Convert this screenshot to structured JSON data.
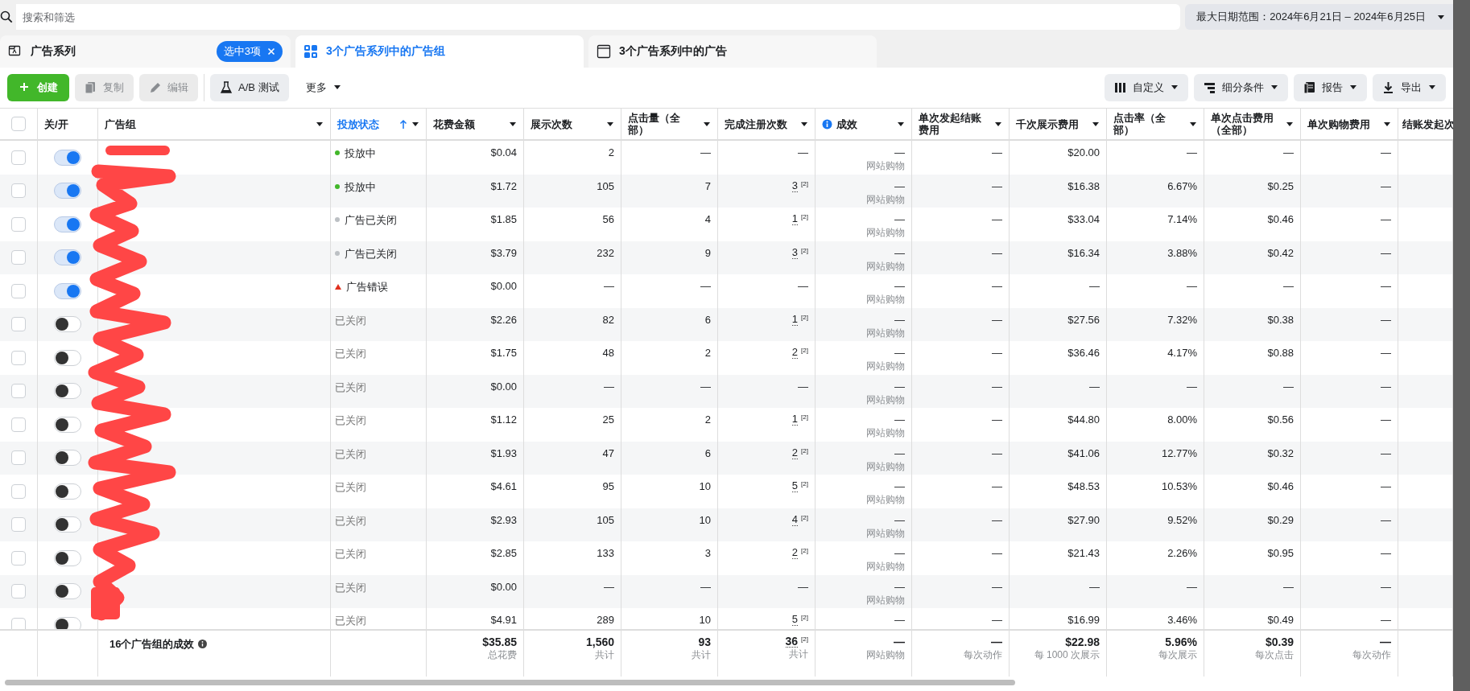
{
  "search": {
    "placeholder": "搜索和筛选"
  },
  "date_range": {
    "label": "最大日期范围：2024年6月21日 – 2024年6月25日"
  },
  "tabs": [
    {
      "label": "广告系列",
      "selected": false,
      "badge": "选中3项"
    },
    {
      "label": "3个广告系列中的广告组",
      "selected": true
    },
    {
      "label": "3个广告系列中的广告",
      "selected": false
    }
  ],
  "toolbar": {
    "left": [
      {
        "label": "创建",
        "kind": "primary",
        "disabled": false
      },
      {
        "label": "复制",
        "kind": "normal",
        "disabled": true
      },
      {
        "label": "编辑",
        "kind": "normal",
        "disabled": true
      },
      {
        "label": "A/B 测试",
        "kind": "normal",
        "disabled": false
      },
      {
        "label": "更多",
        "kind": "menu",
        "disabled": false
      }
    ],
    "right": [
      {
        "label": "自定义",
        "kind": "normal",
        "disabled": false
      },
      {
        "label": "细分条件",
        "kind": "normal",
        "disabled": false
      },
      {
        "label": "报告",
        "kind": "normal",
        "disabled": false
      },
      {
        "label": "导出",
        "kind": "normal",
        "disabled": false
      }
    ]
  },
  "table": {
    "select_all": {
      "checked": false
    },
    "columns": [
      {
        "label": "关/开",
        "sorted": false,
        "menu": false,
        "info": false
      },
      {
        "label": "广告组",
        "sorted": false,
        "menu": true,
        "info": false
      },
      {
        "label": "投放状态",
        "sorted": true,
        "menu": true,
        "info": false
      },
      {
        "label": "花费金额",
        "sorted": false,
        "menu": true,
        "info": false
      },
      {
        "label": "展示次数",
        "sorted": false,
        "menu": true,
        "info": false
      },
      {
        "label": "点击量（全部）",
        "sorted": false,
        "menu": true,
        "info": false
      },
      {
        "label": "完成注册次数",
        "sorted": false,
        "menu": true,
        "info": false
      },
      {
        "label": "成效",
        "sorted": false,
        "menu": true,
        "info": true
      },
      {
        "label": "单次发起结账费用",
        "sorted": false,
        "menu": true,
        "info": false
      },
      {
        "label": "千次展示费用",
        "sorted": false,
        "menu": true,
        "info": false
      },
      {
        "label": "点击率（全部）",
        "sorted": false,
        "menu": true,
        "info": false
      },
      {
        "label": "单次点击费用（全部）",
        "sorted": false,
        "menu": true,
        "info": false
      },
      {
        "label": "单次购物费用",
        "sorted": false,
        "menu": true,
        "info": false
      },
      {
        "label": "结账发起次",
        "sorted": false,
        "info": false
      }
    ],
    "rows": [
      {
        "checked": false,
        "on": true,
        "status": {
          "kind": "active",
          "label": "投放中"
        },
        "cells": [
          "$0.04",
          "2",
          "—",
          {
            "value": "—"
          },
          {
            "value": "—",
            "sub": "网站购物"
          },
          "—",
          "$20.00",
          "—",
          "—",
          "—"
        ]
      },
      {
        "checked": false,
        "on": true,
        "status": {
          "kind": "active",
          "label": "投放中"
        },
        "cells": [
          "$1.72",
          "105",
          "7",
          {
            "value": "3",
            "footnote": "[2]"
          },
          {
            "value": "—",
            "sub": "网站购物"
          },
          "—",
          "$16.38",
          "6.67%",
          "$0.25",
          "—"
        ]
      },
      {
        "checked": false,
        "on": true,
        "status": {
          "kind": "off",
          "label": "广告已关闭"
        },
        "cells": [
          "$1.85",
          "56",
          "4",
          {
            "value": "1",
            "footnote": "[2]"
          },
          {
            "value": "—",
            "sub": "网站购物"
          },
          "—",
          "$33.04",
          "7.14%",
          "$0.46",
          "—"
        ]
      },
      {
        "checked": false,
        "on": true,
        "status": {
          "kind": "off",
          "label": "广告已关闭"
        },
        "cells": [
          "$3.79",
          "232",
          "9",
          {
            "value": "3",
            "footnote": "[2]"
          },
          {
            "value": "—",
            "sub": "网站购物"
          },
          "—",
          "$16.34",
          "3.88%",
          "$0.42",
          "—"
        ]
      },
      {
        "checked": false,
        "on": true,
        "status": {
          "kind": "error",
          "label": "广告错误"
        },
        "cells": [
          "$0.00",
          "—",
          "—",
          {
            "value": "—"
          },
          {
            "value": "—",
            "sub": "网站购物"
          },
          "—",
          "—",
          "—",
          "—",
          "—"
        ]
      },
      {
        "checked": false,
        "on": false,
        "status": {
          "kind": "plain",
          "label": "已关闭"
        },
        "cells": [
          "$2.26",
          "82",
          "6",
          {
            "value": "1",
            "footnote": "[2]"
          },
          {
            "value": "—",
            "sub": "网站购物"
          },
          "—",
          "$27.56",
          "7.32%",
          "$0.38",
          "—"
        ]
      },
      {
        "checked": false,
        "on": false,
        "status": {
          "kind": "plain",
          "label": "已关闭"
        },
        "cells": [
          "$1.75",
          "48",
          "2",
          {
            "value": "2",
            "footnote": "[2]"
          },
          {
            "value": "—",
            "sub": "网站购物"
          },
          "—",
          "$36.46",
          "4.17%",
          "$0.88",
          "—"
        ]
      },
      {
        "checked": false,
        "on": false,
        "status": {
          "kind": "plain",
          "label": "已关闭"
        },
        "cells": [
          "$0.00",
          "—",
          "—",
          {
            "value": "—"
          },
          {
            "value": "—",
            "sub": "网站购物"
          },
          "—",
          "—",
          "—",
          "—",
          "—"
        ]
      },
      {
        "checked": false,
        "on": false,
        "status": {
          "kind": "plain",
          "label": "已关闭"
        },
        "cells": [
          "$1.12",
          "25",
          "2",
          {
            "value": "1",
            "footnote": "[2]"
          },
          {
            "value": "—",
            "sub": "网站购物"
          },
          "—",
          "$44.80",
          "8.00%",
          "$0.56",
          "—"
        ]
      },
      {
        "checked": false,
        "on": false,
        "status": {
          "kind": "plain",
          "label": "已关闭"
        },
        "cells": [
          "$1.93",
          "47",
          "6",
          {
            "value": "2",
            "footnote": "[2]"
          },
          {
            "value": "—",
            "sub": "网站购物"
          },
          "—",
          "$41.06",
          "12.77%",
          "$0.32",
          "—"
        ]
      },
      {
        "checked": false,
        "on": false,
        "status": {
          "kind": "plain",
          "label": "已关闭"
        },
        "cells": [
          "$4.61",
          "95",
          "10",
          {
            "value": "5",
            "footnote": "[2]"
          },
          {
            "value": "—",
            "sub": "网站购物"
          },
          "—",
          "$48.53",
          "10.53%",
          "$0.46",
          "—"
        ]
      },
      {
        "checked": false,
        "on": false,
        "status": {
          "kind": "plain",
          "label": "已关闭"
        },
        "cells": [
          "$2.93",
          "105",
          "10",
          {
            "value": "4",
            "footnote": "[2]"
          },
          {
            "value": "—",
            "sub": "网站购物"
          },
          "—",
          "$27.90",
          "9.52%",
          "$0.29",
          "—"
        ]
      },
      {
        "checked": false,
        "on": false,
        "status": {
          "kind": "plain",
          "label": "已关闭"
        },
        "cells": [
          "$2.85",
          "133",
          "3",
          {
            "value": "2",
            "footnote": "[2]"
          },
          {
            "value": "—",
            "sub": "网站购物"
          },
          "—",
          "$21.43",
          "2.26%",
          "$0.95",
          "—"
        ]
      },
      {
        "checked": false,
        "on": false,
        "status": {
          "kind": "plain",
          "label": "已关闭"
        },
        "cells": [
          "$0.00",
          "—",
          "—",
          {
            "value": "—"
          },
          {
            "value": "—",
            "sub": "网站购物"
          },
          "—",
          "—",
          "—",
          "—",
          "—"
        ]
      },
      {
        "checked": false,
        "on": false,
        "status": {
          "kind": "plain",
          "label": "已关闭"
        },
        "cells": [
          "$4.91",
          "289",
          "10",
          {
            "value": "5",
            "footnote": "[2]"
          },
          {
            "value": "—"
          },
          "—",
          "$16.99",
          "3.46%",
          "$0.49",
          "—"
        ]
      }
    ],
    "summary": {
      "label": "16个广告组的成效",
      "cells": [
        {
          "value": "$35.85",
          "sub": "总花费"
        },
        {
          "value": "1,560",
          "sub": "共计"
        },
        {
          "value": "93",
          "sub": "共计"
        },
        {
          "value": "36",
          "footnote": "[2]",
          "sub": "共计"
        },
        {
          "value": "—",
          "sub": "网站购物"
        },
        {
          "value": "—",
          "sub": "每次动作"
        },
        {
          "value": "$22.98",
          "sub": "每 1000 次展示"
        },
        {
          "value": "5.96%",
          "sub": "每次展示"
        },
        {
          "value": "$0.39",
          "sub": "每次点击"
        },
        {
          "value": "—",
          "sub": "每次动作"
        }
      ]
    }
  }
}
